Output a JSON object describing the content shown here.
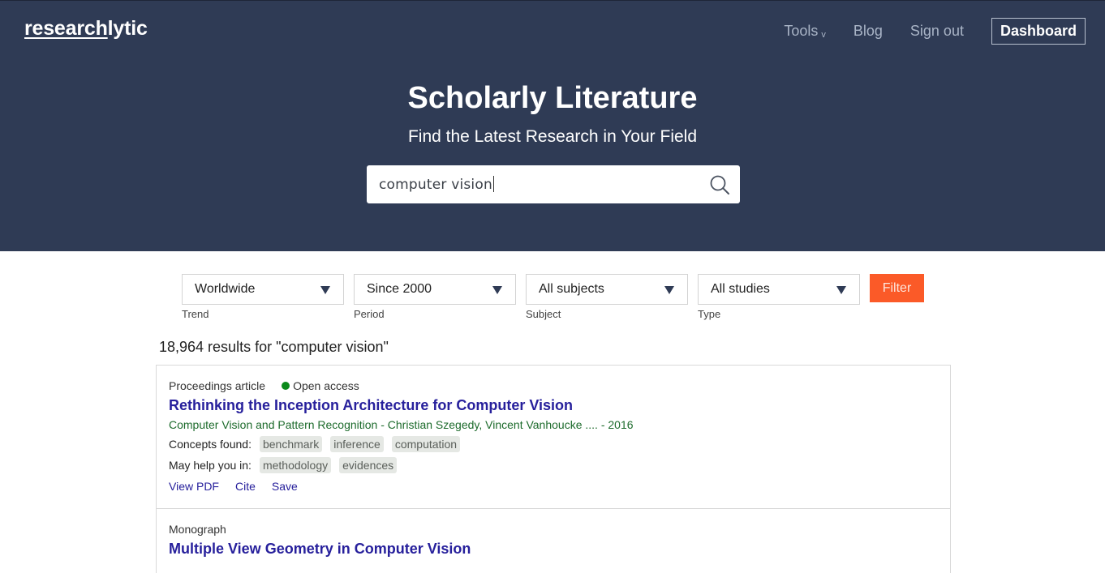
{
  "header": {
    "logo_underlined": "research",
    "logo_rest": "lytic",
    "nav": {
      "tools": "Tools",
      "tools_chevron": "v",
      "blog": "Blog",
      "sign_out": "Sign out",
      "dashboard": "Dashboard"
    }
  },
  "hero": {
    "title": "Scholarly Literature",
    "subtitle": "Find the Latest Research in Your Field",
    "search_value": "computer vision"
  },
  "filters": [
    {
      "value": "Worldwide",
      "label": "Trend"
    },
    {
      "value": "Since 2000",
      "label": "Period"
    },
    {
      "value": "All subjects",
      "label": "Subject"
    },
    {
      "value": "All studies",
      "label": "Type"
    }
  ],
  "filter_button": "Filter",
  "results": {
    "count_text": "18,964 results for \"computer vision\"",
    "items": [
      {
        "type": "Proceedings article",
        "access": "Open access",
        "access_color": "#0a8a1a",
        "title": "Rethinking the Inception Architecture for Computer Vision",
        "source": "Computer Vision and Pattern Recognition - Christian Szegedy, Vincent Vanhoucke .... - 2016",
        "concepts_label": "Concepts found:",
        "concepts": [
          "benchmark",
          "inference",
          "computation"
        ],
        "help_label": "May help you in:",
        "help": [
          "methodology",
          "evidences"
        ],
        "actions": [
          "View PDF",
          "Cite",
          "Save"
        ]
      },
      {
        "type": "Monograph",
        "title": "Multiple View Geometry in Computer Vision"
      }
    ]
  },
  "colors": {
    "hero_bg": "#2f3b55",
    "accent": "#fb5a28",
    "link": "#27209c",
    "source": "#1d6b2c"
  }
}
